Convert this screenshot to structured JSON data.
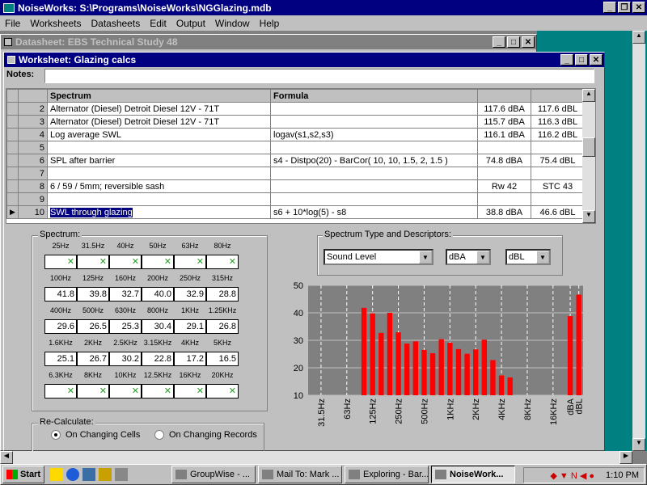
{
  "app": {
    "title": "NoiseWorks: S:\\Programs\\NoiseWorks\\NGGlazing.mdb"
  },
  "menu": [
    "File",
    "Worksheets",
    "Datasheets",
    "Edit",
    "Output",
    "Window",
    "Help"
  ],
  "datasheet": {
    "title": "Datasheet: EBS Technical Study 48"
  },
  "worksheet": {
    "title": "Worksheet: Glazing calcs",
    "notes_label": "Notes:",
    "notes_value": "",
    "columns": [
      "Spectrum",
      "Formula",
      "",
      ""
    ],
    "rows": [
      {
        "n": "2",
        "spectrum": "Alternator (Diesel) Detroit Diesel 12V - 71T",
        "formula": "",
        "a": "117.6 dBA",
        "b": "117.6 dBL"
      },
      {
        "n": "3",
        "spectrum": "Alternator (Diesel) Detroit Diesel 12V - 71T",
        "formula": "",
        "a": "115.7 dBA",
        "b": "116.3 dBL"
      },
      {
        "n": "4",
        "spectrum": "Log average SWL",
        "formula": "logav(s1,s2,s3)",
        "a": "116.1 dBA",
        "b": "116.2 dBL"
      },
      {
        "n": "5",
        "spectrum": "",
        "formula": "",
        "a": "",
        "b": ""
      },
      {
        "n": "6",
        "spectrum": "SPL after barrier",
        "formula": "s4 - Distpo(20) - BarCor( 10, 10, 1.5, 2, 1.5 )",
        "a": "74.8 dBA",
        "b": "75.4 dBL"
      },
      {
        "n": "7",
        "spectrum": "",
        "formula": "",
        "a": "",
        "b": ""
      },
      {
        "n": "8",
        "spectrum": "6 / 59 / 5mm; reversible sash",
        "formula": "",
        "a": "Rw 42",
        "b": "STC 43"
      },
      {
        "n": "9",
        "spectrum": "",
        "formula": "",
        "a": "",
        "b": ""
      },
      {
        "n": "10",
        "spectrum": "SWL through glazing",
        "formula": "s6 + 10*log(5) - s8",
        "a": "38.8 dBA",
        "b": "46.6 dBL"
      }
    ]
  },
  "spectrum_panel": {
    "label": "Spectrum:",
    "rows": [
      {
        "freqs": [
          "25Hz",
          "31.5Hz",
          "40Hz",
          "50Hz",
          "63Hz",
          "80Hz"
        ],
        "values": [
          "",
          "",
          "",
          "",
          "",
          ""
        ]
      },
      {
        "freqs": [
          "100Hz",
          "125Hz",
          "160Hz",
          "200Hz",
          "250Hz",
          "315Hz"
        ],
        "values": [
          "41.8",
          "39.8",
          "32.7",
          "40.0",
          "32.9",
          "28.8"
        ]
      },
      {
        "freqs": [
          "400Hz",
          "500Hz",
          "630Hz",
          "800Hz",
          "1KHz",
          "1.25KHz"
        ],
        "values": [
          "29.6",
          "26.5",
          "25.3",
          "30.4",
          "29.1",
          "26.8"
        ]
      },
      {
        "freqs": [
          "1.6KHz",
          "2KHz",
          "2.5KHz",
          "3.15KHz",
          "4KHz",
          "5KHz"
        ],
        "values": [
          "25.1",
          "26.7",
          "30.2",
          "22.8",
          "17.2",
          "16.5"
        ]
      },
      {
        "freqs": [
          "6.3KHz",
          "8KHz",
          "10KHz",
          "12.5KHz",
          "16KHz",
          "20KHz"
        ],
        "values": [
          "",
          "",
          "",
          "",
          "",
          ""
        ]
      }
    ]
  },
  "descriptors": {
    "label": "Spectrum Type and Descriptors:",
    "type_value": "Sound Level",
    "unit_a": "dBA",
    "unit_b": "dBL"
  },
  "recalc": {
    "label": "Re-Calculate:",
    "option1": "On Changing Cells",
    "option2": "On Changing Records",
    "selected": "option1"
  },
  "chart_data": {
    "type": "bar",
    "ylim": [
      10,
      50
    ],
    "yticks": [
      "10",
      "20",
      "30",
      "40",
      "50"
    ],
    "xticks": [
      "31.5Hz",
      "63Hz",
      "125Hz",
      "250Hz",
      "500Hz",
      "1KHz",
      "2KHz",
      "4KHz",
      "8KHz",
      "16KHz",
      "dBA",
      "dBL"
    ],
    "categories": [
      "25Hz",
      "31.5Hz",
      "40Hz",
      "50Hz",
      "63Hz",
      "80Hz",
      "100Hz",
      "125Hz",
      "160Hz",
      "200Hz",
      "250Hz",
      "315Hz",
      "400Hz",
      "500Hz",
      "630Hz",
      "800Hz",
      "1KHz",
      "1.25KHz",
      "1.6KHz",
      "2KHz",
      "2.5KHz",
      "3.15KHz",
      "4KHz",
      "5KHz",
      "6.3KHz",
      "8KHz",
      "10KHz",
      "12.5KHz",
      "16KHz",
      "20KHz",
      "dBA",
      "dBL"
    ],
    "values": [
      null,
      null,
      null,
      null,
      null,
      null,
      41.8,
      39.8,
      32.7,
      40.0,
      32.9,
      28.8,
      29.6,
      26.5,
      25.3,
      30.4,
      29.1,
      26.8,
      25.1,
      26.7,
      30.2,
      22.8,
      17.2,
      16.5,
      null,
      null,
      null,
      null,
      null,
      null,
      38.8,
      46.6
    ],
    "color": "#ff0000",
    "grid": true
  },
  "taskbar": {
    "start": "Start",
    "buttons": [
      "GroupWise - ...",
      "Mail To: Mark ...",
      "Exploring - Bar...",
      "NoiseWork..."
    ],
    "clock": "1:10 PM"
  }
}
